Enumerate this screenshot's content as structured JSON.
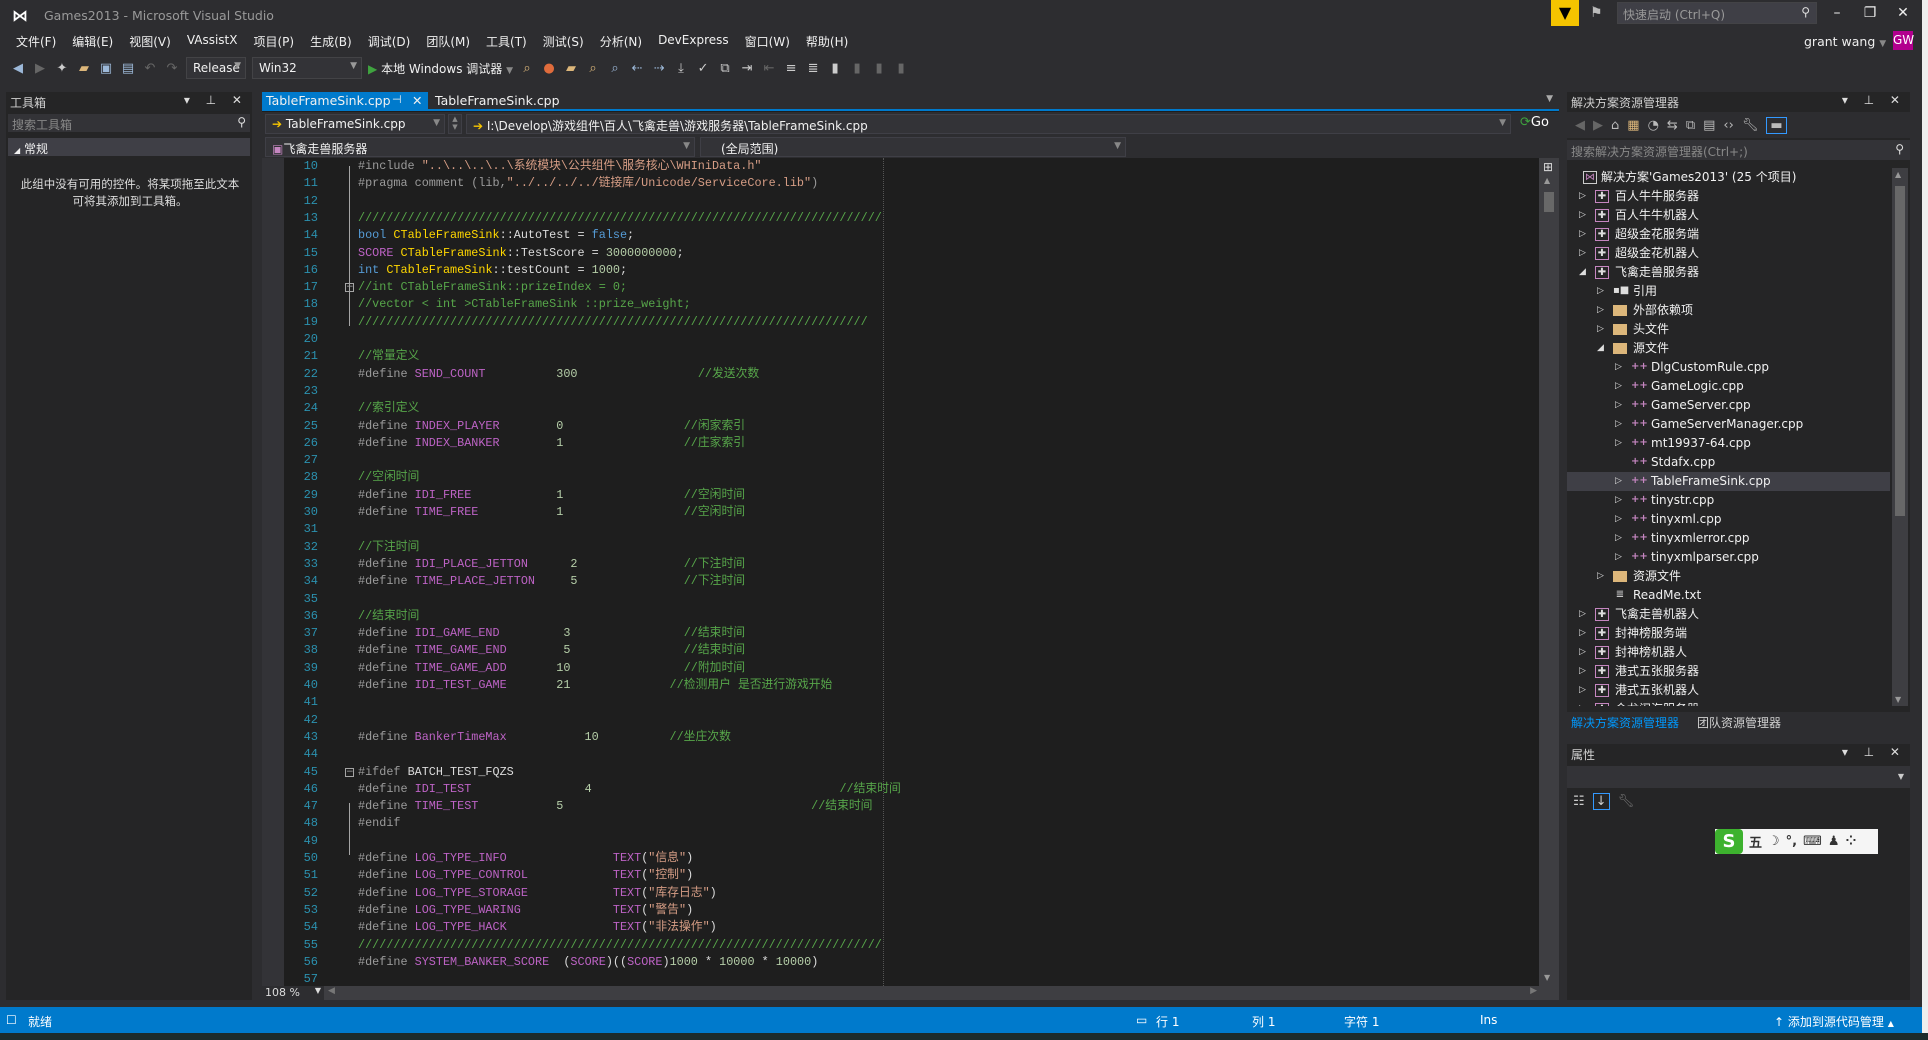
{
  "window": {
    "title": "Games2013 - Microsoft Visual Studio",
    "quick_launch_placeholder": "快速启动 (Ctrl+Q)",
    "user": "grant wang",
    "avatar_initials": "GW",
    "accent": "#007ACC",
    "avatar_color": "#B2008E"
  },
  "menu": [
    "文件(F)",
    "编辑(E)",
    "视图(V)",
    "VAssistX",
    "项目(P)",
    "生成(B)",
    "调试(D)",
    "团队(M)",
    "工具(T)",
    "测试(S)",
    "分析(N)",
    "DevExpress",
    "窗口(W)",
    "帮助(H)"
  ],
  "toolbar": {
    "config": "Release",
    "platform": "Win32",
    "debugger": "本地 Windows 调试器"
  },
  "toolbox": {
    "title": "工具箱",
    "search_placeholder": "搜索工具箱",
    "group": "常规",
    "empty_message": "此组中没有可用的控件。将某项拖至此文本可将其添加到工具箱。"
  },
  "editor": {
    "tabs": [
      {
        "label": "TableFrameSink.cpp",
        "active": true
      },
      {
        "label": "TableFrameSink.cpp",
        "active": false
      }
    ],
    "file_dropdown": "TableFrameSink.cpp",
    "path": "I:\\Develop\\游戏组件\\百人\\飞禽走兽\\游戏服务器\\TableFrameSink.cpp",
    "go_label": "Go",
    "project_dropdown": "飞禽走兽服务器",
    "scope_dropdown": "(全局范围)",
    "zoom": "108 %",
    "lines": [
      {
        "n": 10,
        "s": [
          [
            "pp",
            "#include "
          ],
          [
            "str",
            "\"..\\..\\..\\..\\系统模块\\公共组件\\服务核心\\WHIniData.h\""
          ]
        ]
      },
      {
        "n": 11,
        "s": [
          [
            "pp",
            "#pragma comment (lib,"
          ],
          [
            "str",
            "\"../../../../链接库/Unicode/ServiceCore.lib\""
          ],
          [
            "pp",
            ")"
          ]
        ]
      },
      {
        "n": 12,
        "s": []
      },
      {
        "n": 13,
        "s": [
          [
            "cmt",
            "//////////////////////////////////////////////////////////////////////////"
          ]
        ]
      },
      {
        "n": 14,
        "s": [
          [
            "kw",
            "bool "
          ],
          [
            "cls",
            "CTableFrameSink"
          ],
          [
            "id",
            "::AutoTest = "
          ],
          [
            "kw",
            "false"
          ],
          [
            "id",
            ";"
          ]
        ]
      },
      {
        "n": 15,
        "s": [
          [
            "mac",
            "SCORE "
          ],
          [
            "cls",
            "CTableFrameSink"
          ],
          [
            "id",
            "::TestScore = "
          ],
          [
            "num",
            "3000000000"
          ],
          [
            "id",
            ";"
          ]
        ]
      },
      {
        "n": 16,
        "s": [
          [
            "kw",
            "int "
          ],
          [
            "cls",
            "CTableFrameSink"
          ],
          [
            "id",
            "::testCount = "
          ],
          [
            "num",
            "1000"
          ],
          [
            "id",
            ";"
          ]
        ]
      },
      {
        "n": 17,
        "fold": true,
        "s": [
          [
            "cmt",
            "//int CTableFrameSink::prizeIndex = 0;"
          ]
        ]
      },
      {
        "n": 18,
        "s": [
          [
            "cmt",
            "//vector < int >CTableFrameSink ::prize_weight;"
          ]
        ]
      },
      {
        "n": 19,
        "s": [
          [
            "cmt",
            "////////////////////////////////////////////////////////////////////////"
          ]
        ]
      },
      {
        "n": 20,
        "s": []
      },
      {
        "n": 21,
        "s": [
          [
            "cmt",
            "//常量定义"
          ]
        ]
      },
      {
        "n": 22,
        "s": [
          [
            "pp",
            "#define "
          ],
          [
            "mac",
            "SEND_COUNT"
          ],
          [
            "id",
            "          "
          ],
          [
            "num",
            "300"
          ],
          [
            "id",
            "                 "
          ],
          [
            "cmt",
            "//发送次数"
          ]
        ]
      },
      {
        "n": 23,
        "s": []
      },
      {
        "n": 24,
        "s": [
          [
            "cmt",
            "//索引定义"
          ]
        ]
      },
      {
        "n": 25,
        "s": [
          [
            "pp",
            "#define "
          ],
          [
            "mac",
            "INDEX_PLAYER"
          ],
          [
            "id",
            "        "
          ],
          [
            "num",
            "0"
          ],
          [
            "id",
            "                 "
          ],
          [
            "cmt",
            "//闲家索引"
          ]
        ]
      },
      {
        "n": 26,
        "s": [
          [
            "pp",
            "#define "
          ],
          [
            "mac",
            "INDEX_BANKER"
          ],
          [
            "id",
            "        "
          ],
          [
            "num",
            "1"
          ],
          [
            "id",
            "                 "
          ],
          [
            "cmt",
            "//庄家索引"
          ]
        ]
      },
      {
        "n": 27,
        "s": []
      },
      {
        "n": 28,
        "s": [
          [
            "cmt",
            "//空闲时间"
          ]
        ]
      },
      {
        "n": 29,
        "s": [
          [
            "pp",
            "#define "
          ],
          [
            "mac",
            "IDI_FREE"
          ],
          [
            "id",
            "            "
          ],
          [
            "num",
            "1"
          ],
          [
            "id",
            "                 "
          ],
          [
            "cmt",
            "//空闲时间"
          ]
        ]
      },
      {
        "n": 30,
        "s": [
          [
            "pp",
            "#define "
          ],
          [
            "mac",
            "TIME_FREE"
          ],
          [
            "id",
            "           "
          ],
          [
            "num",
            "1"
          ],
          [
            "id",
            "                 "
          ],
          [
            "cmt",
            "//空闲时间"
          ]
        ]
      },
      {
        "n": 31,
        "s": []
      },
      {
        "n": 32,
        "s": [
          [
            "cmt",
            "//下注时间"
          ]
        ]
      },
      {
        "n": 33,
        "s": [
          [
            "pp",
            "#define "
          ],
          [
            "mac",
            "IDI_PLACE_JETTON"
          ],
          [
            "id",
            "      "
          ],
          [
            "num",
            "2"
          ],
          [
            "id",
            "               "
          ],
          [
            "cmt",
            "//下注时间"
          ]
        ]
      },
      {
        "n": 34,
        "s": [
          [
            "pp",
            "#define "
          ],
          [
            "mac",
            "TIME_PLACE_JETTON"
          ],
          [
            "id",
            "     "
          ],
          [
            "num",
            "5"
          ],
          [
            "id",
            "               "
          ],
          [
            "cmt",
            "//下注时间"
          ]
        ]
      },
      {
        "n": 35,
        "s": []
      },
      {
        "n": 36,
        "s": [
          [
            "cmt",
            "//结束时间"
          ]
        ]
      },
      {
        "n": 37,
        "s": [
          [
            "pp",
            "#define "
          ],
          [
            "mac",
            "IDI_GAME_END"
          ],
          [
            "id",
            "         "
          ],
          [
            "num",
            "3"
          ],
          [
            "id",
            "                "
          ],
          [
            "cmt",
            "//结束时间"
          ]
        ]
      },
      {
        "n": 38,
        "s": [
          [
            "pp",
            "#define "
          ],
          [
            "mac",
            "TIME_GAME_END"
          ],
          [
            "id",
            "        "
          ],
          [
            "num",
            "5"
          ],
          [
            "id",
            "                "
          ],
          [
            "cmt",
            "//结束时间"
          ]
        ]
      },
      {
        "n": 39,
        "s": [
          [
            "pp",
            "#define "
          ],
          [
            "mac",
            "TIME_GAME_ADD"
          ],
          [
            "id",
            "       "
          ],
          [
            "num",
            "10"
          ],
          [
            "id",
            "                "
          ],
          [
            "cmt",
            "//附加时间"
          ]
        ]
      },
      {
        "n": 40,
        "s": [
          [
            "pp",
            "#define "
          ],
          [
            "mac",
            "IDI_TEST_GAME"
          ],
          [
            "id",
            "       "
          ],
          [
            "num",
            "21"
          ],
          [
            "id",
            "              "
          ],
          [
            "cmt",
            "//检测用户 是否进行游戏开始"
          ]
        ]
      },
      {
        "n": 41,
        "s": []
      },
      {
        "n": 42,
        "s": []
      },
      {
        "n": 43,
        "s": [
          [
            "pp",
            "#define "
          ],
          [
            "mac",
            "BankerTimeMax"
          ],
          [
            "id",
            "           "
          ],
          [
            "num",
            "10"
          ],
          [
            "id",
            "          "
          ],
          [
            "cmt",
            "//坐庄次数"
          ]
        ]
      },
      {
        "n": 44,
        "s": []
      },
      {
        "n": 45,
        "fold": true,
        "s": [
          [
            "pp",
            "#ifdef "
          ],
          [
            "id",
            "BATCH_TEST_FQZS"
          ]
        ]
      },
      {
        "n": 46,
        "s": [
          [
            "pp",
            "#define "
          ],
          [
            "mac",
            "IDI_TEST"
          ],
          [
            "id",
            "                "
          ],
          [
            "num",
            "4"
          ],
          [
            "id",
            "                                   "
          ],
          [
            "cmt",
            "//结束时间"
          ]
        ]
      },
      {
        "n": 47,
        "s": [
          [
            "pp",
            "#define "
          ],
          [
            "mac",
            "TIME_TEST"
          ],
          [
            "id",
            "           "
          ],
          [
            "num",
            "5"
          ],
          [
            "id",
            "                                   "
          ],
          [
            "cmt",
            "//结束时间"
          ]
        ]
      },
      {
        "n": 48,
        "s": [
          [
            "pp",
            "#endif"
          ]
        ]
      },
      {
        "n": 49,
        "s": []
      },
      {
        "n": 50,
        "s": [
          [
            "pp",
            "#define "
          ],
          [
            "mac",
            "LOG_TYPE_INFO"
          ],
          [
            "id",
            "               "
          ],
          [
            "mac",
            "TEXT"
          ],
          [
            "id",
            "("
          ],
          [
            "str",
            "\"信息\""
          ],
          [
            "id",
            ")"
          ]
        ]
      },
      {
        "n": 51,
        "s": [
          [
            "pp",
            "#define "
          ],
          [
            "mac",
            "LOG_TYPE_CONTROL"
          ],
          [
            "id",
            "            "
          ],
          [
            "mac",
            "TEXT"
          ],
          [
            "id",
            "("
          ],
          [
            "str",
            "\"控制\""
          ],
          [
            "id",
            ")"
          ]
        ]
      },
      {
        "n": 52,
        "s": [
          [
            "pp",
            "#define "
          ],
          [
            "mac",
            "LOG_TYPE_STORAGE"
          ],
          [
            "id",
            "            "
          ],
          [
            "mac",
            "TEXT"
          ],
          [
            "id",
            "("
          ],
          [
            "str",
            "\"库存日志\""
          ],
          [
            "id",
            ")"
          ]
        ]
      },
      {
        "n": 53,
        "s": [
          [
            "pp",
            "#define "
          ],
          [
            "mac",
            "LOG_TYPE_WARING"
          ],
          [
            "id",
            "             "
          ],
          [
            "mac",
            "TEXT"
          ],
          [
            "id",
            "("
          ],
          [
            "str",
            "\"警告\""
          ],
          [
            "id",
            ")"
          ]
        ]
      },
      {
        "n": 54,
        "s": [
          [
            "pp",
            "#define "
          ],
          [
            "mac",
            "LOG_TYPE_HACK"
          ],
          [
            "id",
            "               "
          ],
          [
            "mac",
            "TEXT"
          ],
          [
            "id",
            "("
          ],
          [
            "str",
            "\"非法操作\""
          ],
          [
            "id",
            ")"
          ]
        ]
      },
      {
        "n": 55,
        "s": [
          [
            "cmt",
            "//////////////////////////////////////////////////////////////////////////"
          ]
        ]
      },
      {
        "n": 56,
        "s": [
          [
            "pp",
            "#define "
          ],
          [
            "mac",
            "SYSTEM_BANKER_SCORE"
          ],
          [
            "id",
            "  ("
          ],
          [
            "mac",
            "SCORE"
          ],
          [
            "id",
            ")(("
          ],
          [
            "mac",
            "SCORE"
          ],
          [
            "id",
            ")"
          ],
          [
            "num",
            "1000"
          ],
          [
            "id",
            " * "
          ],
          [
            "num",
            "10000"
          ],
          [
            "id",
            " * "
          ],
          [
            "num",
            "10000"
          ],
          [
            "id",
            ")"
          ]
        ]
      },
      {
        "n": 57,
        "s": []
      }
    ]
  },
  "solution_explorer": {
    "title": "解决方案资源管理器",
    "search_placeholder": "搜索解决方案资源管理器(Ctrl+;)",
    "items": [
      {
        "label": "解决方案'Games2013' (25 个项目)",
        "level": 0,
        "exp": "none",
        "icon": "solution"
      },
      {
        "label": "百人牛牛服务器",
        "level": 1,
        "exp": "collapsed",
        "icon": "project"
      },
      {
        "label": "百人牛牛机器人",
        "level": 1,
        "exp": "collapsed",
        "icon": "project"
      },
      {
        "label": "超级金花服务端",
        "level": 1,
        "exp": "collapsed",
        "icon": "project"
      },
      {
        "label": "超级金花机器人",
        "level": 1,
        "exp": "collapsed",
        "icon": "project"
      },
      {
        "label": "飞禽走兽服务器",
        "level": 1,
        "exp": "expanded",
        "icon": "project"
      },
      {
        "label": "引用",
        "level": 2,
        "exp": "collapsed",
        "icon": "references"
      },
      {
        "label": "外部依赖项",
        "level": 2,
        "exp": "collapsed",
        "icon": "ext-deps"
      },
      {
        "label": "头文件",
        "level": 2,
        "exp": "collapsed",
        "icon": "folder"
      },
      {
        "label": "源文件",
        "level": 2,
        "exp": "expanded",
        "icon": "folder"
      },
      {
        "label": "DlgCustomRule.cpp",
        "level": 3,
        "exp": "collapsed",
        "icon": "cpp"
      },
      {
        "label": "GameLogic.cpp",
        "level": 3,
        "exp": "collapsed",
        "icon": "cpp"
      },
      {
        "label": "GameServer.cpp",
        "level": 3,
        "exp": "collapsed",
        "icon": "cpp"
      },
      {
        "label": "GameServerManager.cpp",
        "level": 3,
        "exp": "collapsed",
        "icon": "cpp"
      },
      {
        "label": "mt19937-64.cpp",
        "level": 3,
        "exp": "collapsed",
        "icon": "cpp"
      },
      {
        "label": "Stdafx.cpp",
        "level": 3,
        "exp": "none",
        "icon": "cpp"
      },
      {
        "label": "TableFrameSink.cpp",
        "level": 3,
        "exp": "collapsed",
        "icon": "cpp",
        "selected": true
      },
      {
        "label": "tinystr.cpp",
        "level": 3,
        "exp": "collapsed",
        "icon": "cpp"
      },
      {
        "label": "tinyxml.cpp",
        "level": 3,
        "exp": "collapsed",
        "icon": "cpp"
      },
      {
        "label": "tinyxmlerror.cpp",
        "level": 3,
        "exp": "collapsed",
        "icon": "cpp"
      },
      {
        "label": "tinyxmlparser.cpp",
        "level": 3,
        "exp": "collapsed",
        "icon": "cpp"
      },
      {
        "label": "资源文件",
        "level": 2,
        "exp": "collapsed",
        "icon": "folder"
      },
      {
        "label": "ReadMe.txt",
        "level": 2,
        "exp": "none",
        "icon": "txt"
      },
      {
        "label": "飞禽走兽机器人",
        "level": 1,
        "exp": "collapsed",
        "icon": "project"
      },
      {
        "label": "封神榜服务端",
        "level": 1,
        "exp": "collapsed",
        "icon": "project"
      },
      {
        "label": "封神榜机器人",
        "level": 1,
        "exp": "collapsed",
        "icon": "project"
      },
      {
        "label": "港式五张服务器",
        "level": 1,
        "exp": "collapsed",
        "icon": "project"
      },
      {
        "label": "港式五张机器人",
        "level": 1,
        "exp": "collapsed",
        "icon": "project"
      },
      {
        "label": "金龙闹海服务器",
        "level": 1,
        "exp": "collapsed",
        "icon": "project"
      }
    ],
    "tabs": [
      "解决方案资源管理器",
      "团队资源管理器"
    ]
  },
  "properties": {
    "title": "属性"
  },
  "ime": {
    "mode": "五"
  },
  "statusbar": {
    "ready": "就绪",
    "line": "行 1",
    "col": "列 1",
    "char": "字符 1",
    "ins": "Ins",
    "source_control": "添加到源代码管理"
  }
}
